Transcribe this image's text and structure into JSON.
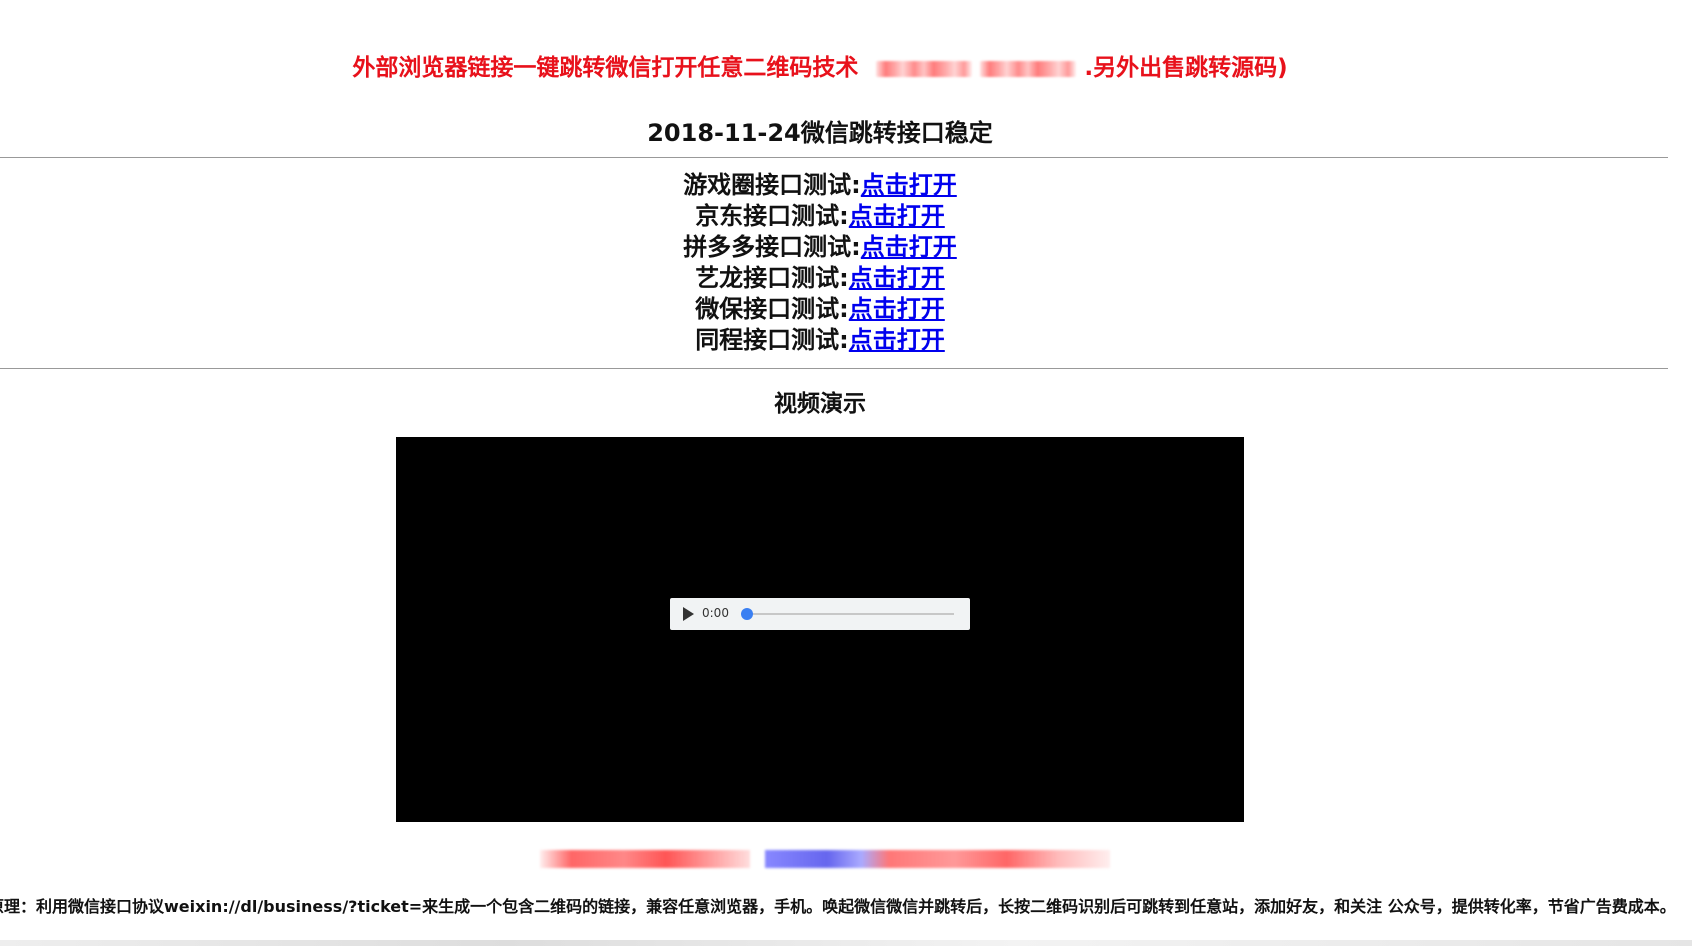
{
  "header": {
    "banner_text_start": "外部浏览器链接一键跳转微信打开任意二维码技术",
    "banner_text_end": ".另外出售跳转源码)",
    "subtitle": "2018-11-24微信跳转接口稳定"
  },
  "tests": [
    {
      "label": "游戏圈接口测试:",
      "link": "点击打开"
    },
    {
      "label": "京东接口测试:",
      "link": "点击打开"
    },
    {
      "label": "拼多多接口测试:",
      "link": "点击打开"
    },
    {
      "label": "艺龙接口测试:",
      "link": "点击打开"
    },
    {
      "label": "微保接口测试:",
      "link": "点击打开"
    },
    {
      "label": "同程接口测试:",
      "link": "点击打开"
    }
  ],
  "video_section": {
    "heading": "视频演示",
    "player": {
      "time": "0:00",
      "progress_fraction": 0.0,
      "play_icon": "play-icon"
    }
  },
  "footer": {
    "principle": "原理：利用微信接口协议weixin://dl/business/?ticket=来生成一个包含二维码的链接，兼容任意浏览器，手机。唤起微信微信并跳转后，长按二维码识别后可跳转到任意站，添加好友，和关注 公众号，提供转化率，节省广告费成本。"
  },
  "colors": {
    "banner": "#e8111b",
    "link": "#0000ee",
    "video_bg": "#000000",
    "player_bg": "#f1f3f4",
    "player_thumb": "#3a7ff2"
  }
}
